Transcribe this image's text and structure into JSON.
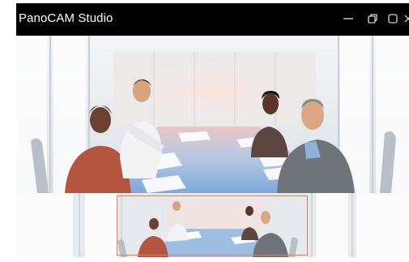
{
  "window": {
    "title": "PanoCAM Studio"
  },
  "controls": {
    "minimize_icon": "minimize-icon",
    "restore_icon": "restore-icon",
    "maximize_icon": "maximize-icon",
    "close_icon": "close-icon"
  },
  "colors": {
    "titlebar_bg": "#000000",
    "title_text": "#ffffff",
    "selection_frame": "#ef7a4a",
    "table_blue": "#8fb7e0"
  }
}
